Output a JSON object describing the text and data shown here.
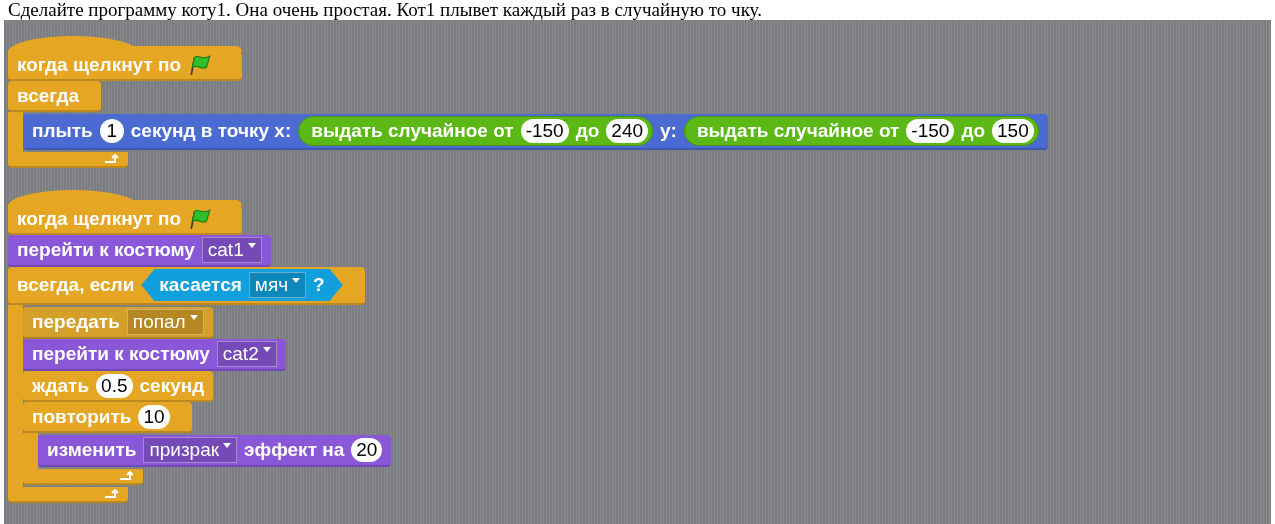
{
  "instruction": "Сделайте программу коту1. Она очень простая. Кот1 плывет каждый раз в случайную то чку.",
  "scripts": [
    {
      "blocks": [
        {
          "kind": "hat",
          "color": "#e5a723",
          "parts": [
            {
              "kind": "text",
              "text": "когда щелкнут по"
            },
            {
              "kind": "flag"
            }
          ]
        },
        {
          "kind": "c",
          "color": "#e5a723",
          "parts": [
            {
              "kind": "text",
              "text": "всегда"
            }
          ],
          "children": [
            {
              "kind": "stack",
              "color": "#4b6bd3",
              "parts": [
                {
                  "kind": "text",
                  "text": "плыть"
                },
                {
                  "kind": "number",
                  "text": "1"
                },
                {
                  "kind": "text",
                  "text": "секунд в точку x:"
                },
                {
                  "kind": "reporter",
                  "color": "#5cb815",
                  "parts": [
                    {
                      "kind": "text",
                      "text": "выдать случайное от"
                    },
                    {
                      "kind": "number",
                      "text": "-150"
                    },
                    {
                      "kind": "text",
                      "text": "до"
                    },
                    {
                      "kind": "number",
                      "text": "240"
                    }
                  ]
                },
                {
                  "kind": "text",
                  "text": "y:"
                },
                {
                  "kind": "reporter",
                  "color": "#5cb815",
                  "parts": [
                    {
                      "kind": "text",
                      "text": "выдать случайное от"
                    },
                    {
                      "kind": "number",
                      "text": "-150"
                    },
                    {
                      "kind": "text",
                      "text": "до"
                    },
                    {
                      "kind": "number",
                      "text": "150"
                    }
                  ]
                }
              ]
            }
          ]
        }
      ]
    },
    {
      "blocks": [
        {
          "kind": "hat",
          "color": "#e5a723",
          "parts": [
            {
              "kind": "text",
              "text": "когда щелкнут по"
            },
            {
              "kind": "flag"
            }
          ]
        },
        {
          "kind": "stack",
          "color": "#8a57d9",
          "parts": [
            {
              "kind": "text",
              "text": "перейти к костюму"
            },
            {
              "kind": "dropdown",
              "text": "cat1"
            }
          ]
        },
        {
          "kind": "c",
          "color": "#e5a723",
          "parts": [
            {
              "kind": "text",
              "text": "всегда, если"
            },
            {
              "kind": "boolean",
              "color": "#119fdd",
              "parts": [
                {
                  "kind": "text",
                  "text": "касается"
                },
                {
                  "kind": "dropdown",
                  "text": "мяч"
                },
                {
                  "kind": "text",
                  "text": "?"
                }
              ]
            }
          ],
          "children": [
            {
              "kind": "stack",
              "color": "#d5a02a",
              "parts": [
                {
                  "kind": "text",
                  "text": "передать"
                },
                {
                  "kind": "dropdown",
                  "text": "попал"
                }
              ]
            },
            {
              "kind": "stack",
              "color": "#8a57d9",
              "parts": [
                {
                  "kind": "text",
                  "text": "перейти к костюму"
                },
                {
                  "kind": "dropdown",
                  "text": "cat2"
                }
              ]
            },
            {
              "kind": "stack",
              "color": "#e5a723",
              "parts": [
                {
                  "kind": "text",
                  "text": "ждать"
                },
                {
                  "kind": "number",
                  "text": "0.5"
                },
                {
                  "kind": "text",
                  "text": "секунд"
                }
              ]
            },
            {
              "kind": "c",
              "color": "#e5a723",
              "parts": [
                {
                  "kind": "text",
                  "text": "повторить"
                },
                {
                  "kind": "number",
                  "text": "10"
                }
              ],
              "children": [
                {
                  "kind": "stack",
                  "color": "#8a57d9",
                  "parts": [
                    {
                      "kind": "text",
                      "text": "изменить"
                    },
                    {
                      "kind": "dropdown",
                      "text": "призрак"
                    },
                    {
                      "kind": "text",
                      "text": "эффект на"
                    },
                    {
                      "kind": "number",
                      "text": "20"
                    }
                  ]
                }
              ]
            }
          ]
        }
      ]
    }
  ]
}
